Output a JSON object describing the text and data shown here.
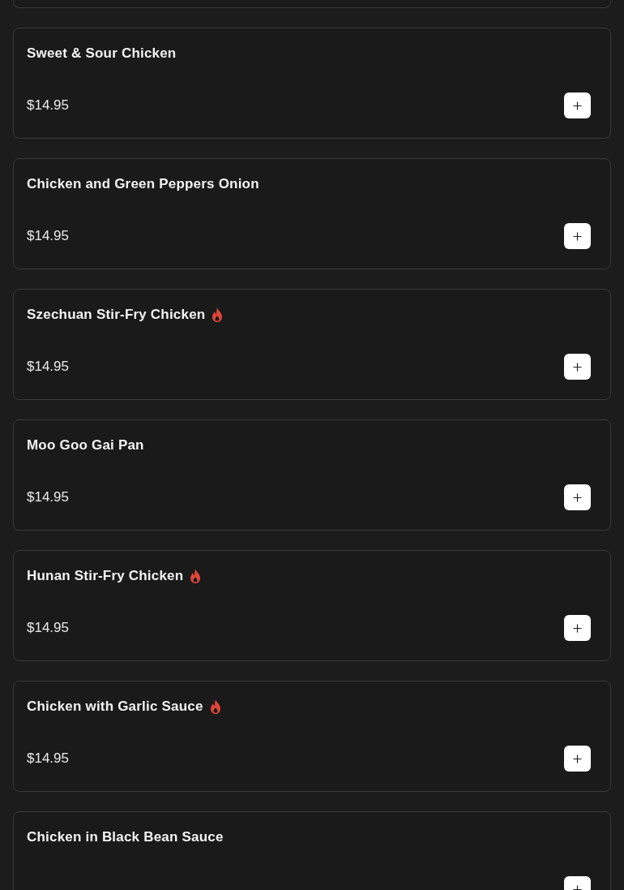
{
  "menu_items": [
    {
      "name": "Sweet & Sour Chicken",
      "spicy": false,
      "price": "$14.95"
    },
    {
      "name": "Chicken and Green Peppers Onion",
      "spicy": false,
      "price": "$14.95"
    },
    {
      "name": "Szechuan Stir-Fry Chicken",
      "spicy": true,
      "price": "$14.95"
    },
    {
      "name": "Moo Goo Gai Pan",
      "spicy": false,
      "price": "$14.95"
    },
    {
      "name": "Hunan Stir-Fry Chicken",
      "spicy": true,
      "price": "$14.95"
    },
    {
      "name": "Chicken with Garlic Sauce",
      "spicy": true,
      "price": "$14.95"
    },
    {
      "name": "Chicken in Black Bean Sauce",
      "spicy": false
    }
  ]
}
